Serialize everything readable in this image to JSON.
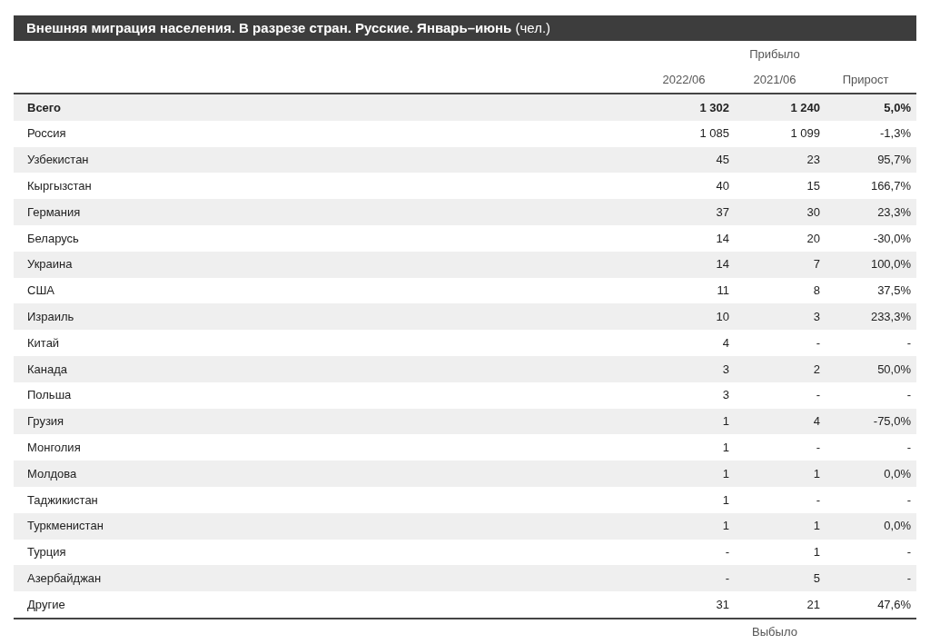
{
  "title": "**Внешняя миграция населения. В разрезе стран. Русские. Январь–июнь** (чел.)",
  "header": {
    "group_label": "Прибыло",
    "columns": [
      "2022/06",
      "2021/06",
      "Прирост"
    ]
  },
  "rows": [
    {
      "kind": "total",
      "country": "Всего",
      "values": [
        "1 302",
        "1 240",
        "5,0%"
      ]
    },
    {
      "kind": "country",
      "country": "Россия",
      "values": [
        "1 085",
        "1 099",
        "-1,3%"
      ]
    },
    {
      "kind": "country",
      "country": "Узбекистан",
      "values": [
        "45",
        "23",
        "95,7%"
      ]
    },
    {
      "kind": "country",
      "country": "Кыргызстан",
      "values": [
        "40",
        "15",
        "166,7%"
      ]
    },
    {
      "kind": "country",
      "country": "Германия",
      "values": [
        "37",
        "30",
        "23,3%"
      ]
    },
    {
      "kind": "country",
      "country": "Беларусь",
      "values": [
        "14",
        "20",
        "-30,0%"
      ]
    },
    {
      "kind": "country",
      "country": "Украина",
      "values": [
        "14",
        "7",
        "100,0%"
      ]
    },
    {
      "kind": "country",
      "country": "США",
      "values": [
        "11",
        "8",
        "37,5%"
      ]
    },
    {
      "kind": "country",
      "country": "Израиль",
      "values": [
        "10",
        "3",
        "233,3%"
      ]
    },
    {
      "kind": "country",
      "country": "Китай",
      "values": [
        "4",
        "-",
        "-"
      ]
    },
    {
      "kind": "country",
      "country": "Канада",
      "values": [
        "3",
        "2",
        "50,0%"
      ]
    },
    {
      "kind": "country",
      "country": "Польша",
      "values": [
        "3",
        "-",
        "-"
      ]
    },
    {
      "kind": "country",
      "country": "Грузия",
      "values": [
        "1",
        "4",
        "-75,0%"
      ]
    },
    {
      "kind": "country",
      "country": "Монголия",
      "values": [
        "1",
        "-",
        "-"
      ]
    },
    {
      "kind": "country",
      "country": "Молдова",
      "values": [
        "1",
        "1",
        "0,0%"
      ]
    },
    {
      "kind": "country",
      "country": "Таджикистан",
      "values": [
        "1",
        "-",
        "-"
      ]
    },
    {
      "kind": "country",
      "country": "Туркменистан",
      "values": [
        "1",
        "1",
        "0,0%"
      ]
    },
    {
      "kind": "country",
      "country": "Турция",
      "values": [
        "-",
        "1",
        "-"
      ]
    },
    {
      "kind": "country",
      "country": "Азербайджан",
      "values": [
        "-",
        "5",
        "-"
      ]
    },
    {
      "kind": "country",
      "country": "Другие",
      "values": [
        "31",
        "21",
        "47,6%"
      ]
    }
  ],
  "footer_label": "Выбыло"
}
